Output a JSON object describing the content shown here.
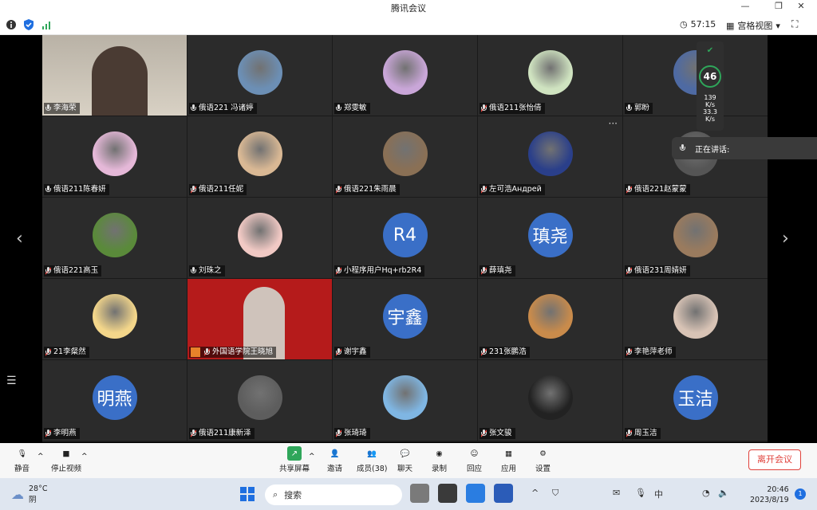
{
  "window": {
    "title": "腾讯会议"
  },
  "toolbar": {
    "timer": "57:15",
    "view_label": "宫格视图"
  },
  "tiles": [
    {
      "name": "李海荣",
      "type": "video",
      "muted": false
    },
    {
      "name": "俄语221 冯诸婷",
      "type": "img",
      "color": "#6c8fb5",
      "muted": false
    },
    {
      "name": "郑雯敏",
      "type": "img",
      "color": "#c9a6d8",
      "muted": false
    },
    {
      "name": "俄语211张怡倩",
      "type": "img",
      "color": "#cfe3c0",
      "muted": true
    },
    {
      "name": "郭盼",
      "type": "img",
      "color": "#4e6aa3",
      "muted": false
    },
    {
      "name": "俄语211陈春妍",
      "type": "img",
      "color": "#e5b8d8",
      "muted": false
    },
    {
      "name": "俄语211任妮",
      "type": "img",
      "color": "#d9b894",
      "muted": true
    },
    {
      "name": "俄语221朱雨晨",
      "type": "img",
      "color": "#8a7055",
      "muted": true
    },
    {
      "name": "左可浩Андрей",
      "type": "img",
      "color": "#2a3f8a",
      "muted": true
    },
    {
      "name": "俄语221赵蒙蒙",
      "type": "img",
      "color": "#555555",
      "muted": true
    },
    {
      "name": "俄语221高玉",
      "type": "img",
      "color": "#5a8a3a",
      "muted": true
    },
    {
      "name": "刘珠之",
      "type": "img",
      "color": "#f1c9c4",
      "muted": false
    },
    {
      "name": "小程序用户Hq+rb2R4",
      "type": "text",
      "avatar": "R4",
      "muted": true
    },
    {
      "name": "薛瑱尧",
      "type": "text",
      "avatar": "瑱尧",
      "muted": true
    },
    {
      "name": "俄语231周婧妍",
      "type": "img",
      "color": "#9a7b5e",
      "muted": true
    },
    {
      "name": "21李粲然",
      "type": "img",
      "color": "#f3d68a",
      "muted": true
    },
    {
      "name": "外国语学院王晓旭",
      "type": "video2",
      "muted": true
    },
    {
      "name": "谢宇鑫",
      "type": "text",
      "avatar": "宇鑫",
      "muted": true
    },
    {
      "name": "231张鹏浩",
      "type": "img",
      "color": "#c98b4b",
      "muted": true
    },
    {
      "name": "李艳萍老师",
      "type": "img",
      "color": "#d8c3b5",
      "muted": true
    },
    {
      "name": "李明燕",
      "type": "text",
      "avatar": "明燕",
      "muted": true
    },
    {
      "name": "俄语211康新泽",
      "type": "img",
      "color": "#5d5d5d",
      "muted": true
    },
    {
      "name": "张琦琦",
      "type": "img",
      "color": "#7fb6e3",
      "muted": true
    },
    {
      "name": "张文骏",
      "type": "img",
      "color": "#222222",
      "muted": true
    },
    {
      "name": "周玉洁",
      "type": "text",
      "avatar": "玉洁",
      "muted": true
    }
  ],
  "speaking": {
    "label": "正在讲话:"
  },
  "network": {
    "score": "46",
    "up": "139",
    "up_unit": "K/s",
    "down": "33.3",
    "down_unit": "K/s"
  },
  "controls": {
    "mute": "静音",
    "stop_video": "停止视频",
    "share": "共享屏幕",
    "invite": "邀请",
    "members": "成员(38)",
    "chat": "聊天",
    "record": "录制",
    "reply": "回应",
    "apps": "应用",
    "settings": "设置",
    "leave": "离开会议"
  },
  "taskbar": {
    "temp": "28°C",
    "weather": "阴",
    "search": "搜索",
    "time": "20:46",
    "date": "2023/8/19",
    "ime": "中",
    "notif": "1"
  }
}
